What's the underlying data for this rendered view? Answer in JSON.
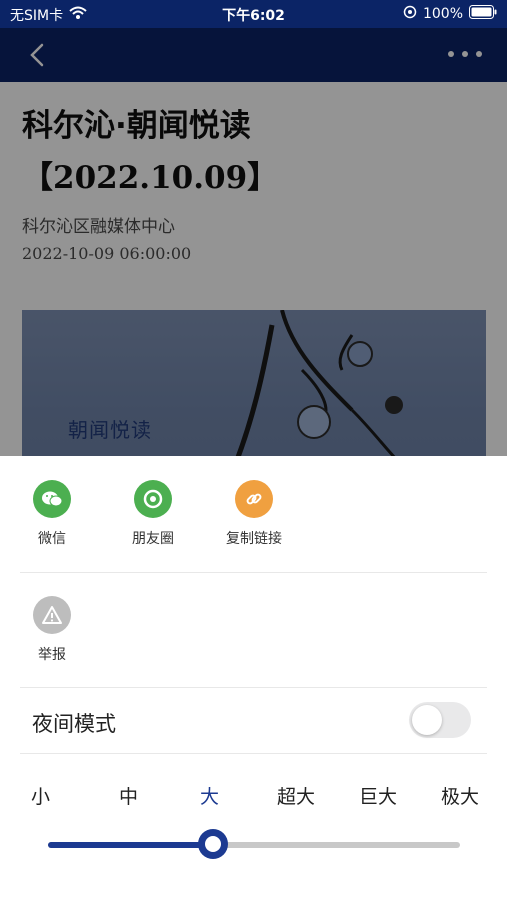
{
  "status_bar": {
    "carrier": "无SIM卡",
    "time": "下午6:02",
    "battery": "100%"
  },
  "nav": {
    "back_icon": "chevron-left-icon",
    "more_icon": "more-icon"
  },
  "article": {
    "title_line1": "科尔沁·朝闻悦读",
    "title_line2": "【2022.10.09】",
    "source": "科尔沁区融媒体中心",
    "date": "2022-10-09 06:00:00",
    "cover_logo": "朝闻悦读"
  },
  "share": {
    "items": [
      {
        "label": "微信",
        "icon": "wechat-icon",
        "color": "#4caf50"
      },
      {
        "label": "朋友圈",
        "icon": "moments-icon",
        "color": "#4caf50"
      },
      {
        "label": "复制链接",
        "icon": "link-icon",
        "color": "#f0a040"
      }
    ],
    "report": {
      "label": "举报",
      "icon": "warning-icon"
    }
  },
  "night_mode": {
    "label": "夜间模式",
    "enabled": false
  },
  "font_size": {
    "options": [
      "小",
      "中",
      "大",
      "超大",
      "巨大",
      "极大"
    ],
    "selected_index": 2
  },
  "colors": {
    "brand": "#0b2466",
    "accent": "#1c3a91"
  }
}
